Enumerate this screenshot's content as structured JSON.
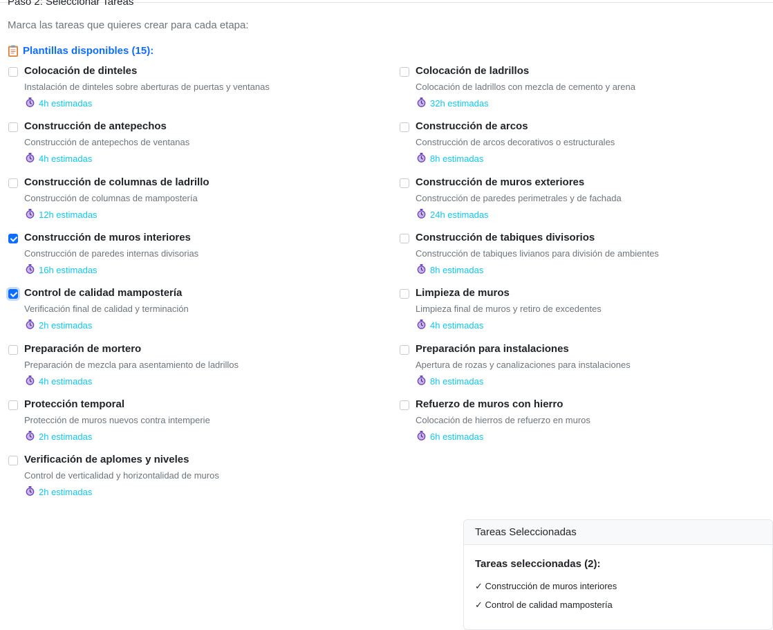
{
  "step_title": "Paso 2: Seleccionar Tareas",
  "instructions": "Marca las tareas que quieres crear para cada etapa:",
  "templates_label": "Plantillas disponibles (15):",
  "templates_icon": "clipboard-icon",
  "timer_icon": "stopwatch-icon",
  "colors": {
    "accent": "#0d6efd",
    "hours": "#0dcaf0",
    "muted": "#6c757d"
  },
  "tasks_left": [
    {
      "title": "Colocación de dinteles",
      "desc": "Instalación de dinteles sobre aberturas de puertas y ventanas",
      "hours": "4h estimadas",
      "checked": false
    },
    {
      "title": "Construcción de antepechos",
      "desc": "Construcción de antepechos de ventanas",
      "hours": "4h estimadas",
      "checked": false
    },
    {
      "title": "Construcción de columnas de ladrillo",
      "desc": "Construcción de columnas de mampostería",
      "hours": "12h estimadas",
      "checked": false
    },
    {
      "title": "Construcción de muros interiores",
      "desc": "Construcción de paredes internas divisorias",
      "hours": "16h estimadas",
      "checked": true
    },
    {
      "title": "Control de calidad mampostería",
      "desc": "Verificación final de calidad y terminación",
      "hours": "2h estimadas",
      "checked": true
    },
    {
      "title": "Preparación de mortero",
      "desc": "Preparación de mezcla para asentamiento de ladrillos",
      "hours": "4h estimadas",
      "checked": false
    },
    {
      "title": "Protección temporal",
      "desc": "Protección de muros nuevos contra intemperie",
      "hours": "2h estimadas",
      "checked": false
    },
    {
      "title": "Verificación de aplomes y niveles",
      "desc": "Control de verticalidad y horizontalidad de muros",
      "hours": "2h estimadas",
      "checked": false
    }
  ],
  "tasks_right": [
    {
      "title": "Colocación de ladrillos",
      "desc": "Colocación de ladrillos con mezcla de cemento y arena",
      "hours": "32h estimadas",
      "checked": false
    },
    {
      "title": "Construcción de arcos",
      "desc": "Construcción de arcos decorativos o estructurales",
      "hours": "8h estimadas",
      "checked": false
    },
    {
      "title": "Construcción de muros exteriores",
      "desc": "Construcción de paredes perimetrales y de fachada",
      "hours": "24h estimadas",
      "checked": false
    },
    {
      "title": "Construcción de tabiques divisorios",
      "desc": "Construcción de tabiques livianos para división de ambientes",
      "hours": "8h estimadas",
      "checked": false
    },
    {
      "title": "Limpieza de muros",
      "desc": "Limpieza final de muros y retiro de excedentes",
      "hours": "4h estimadas",
      "checked": false
    },
    {
      "title": "Preparación para instalaciones",
      "desc": "Apertura de rozas y canalizaciones para instalaciones",
      "hours": "8h estimadas",
      "checked": false
    },
    {
      "title": "Refuerzo de muros con hierro",
      "desc": "Colocación de hierros de refuerzo en muros",
      "hours": "6h estimadas",
      "checked": false
    }
  ],
  "selected_panel": {
    "header": "Tareas Seleccionadas",
    "subtitle": "Tareas seleccionadas (2):",
    "items": [
      "✓ Construcción de muros interiores",
      "✓ Control de calidad mampostería"
    ]
  }
}
